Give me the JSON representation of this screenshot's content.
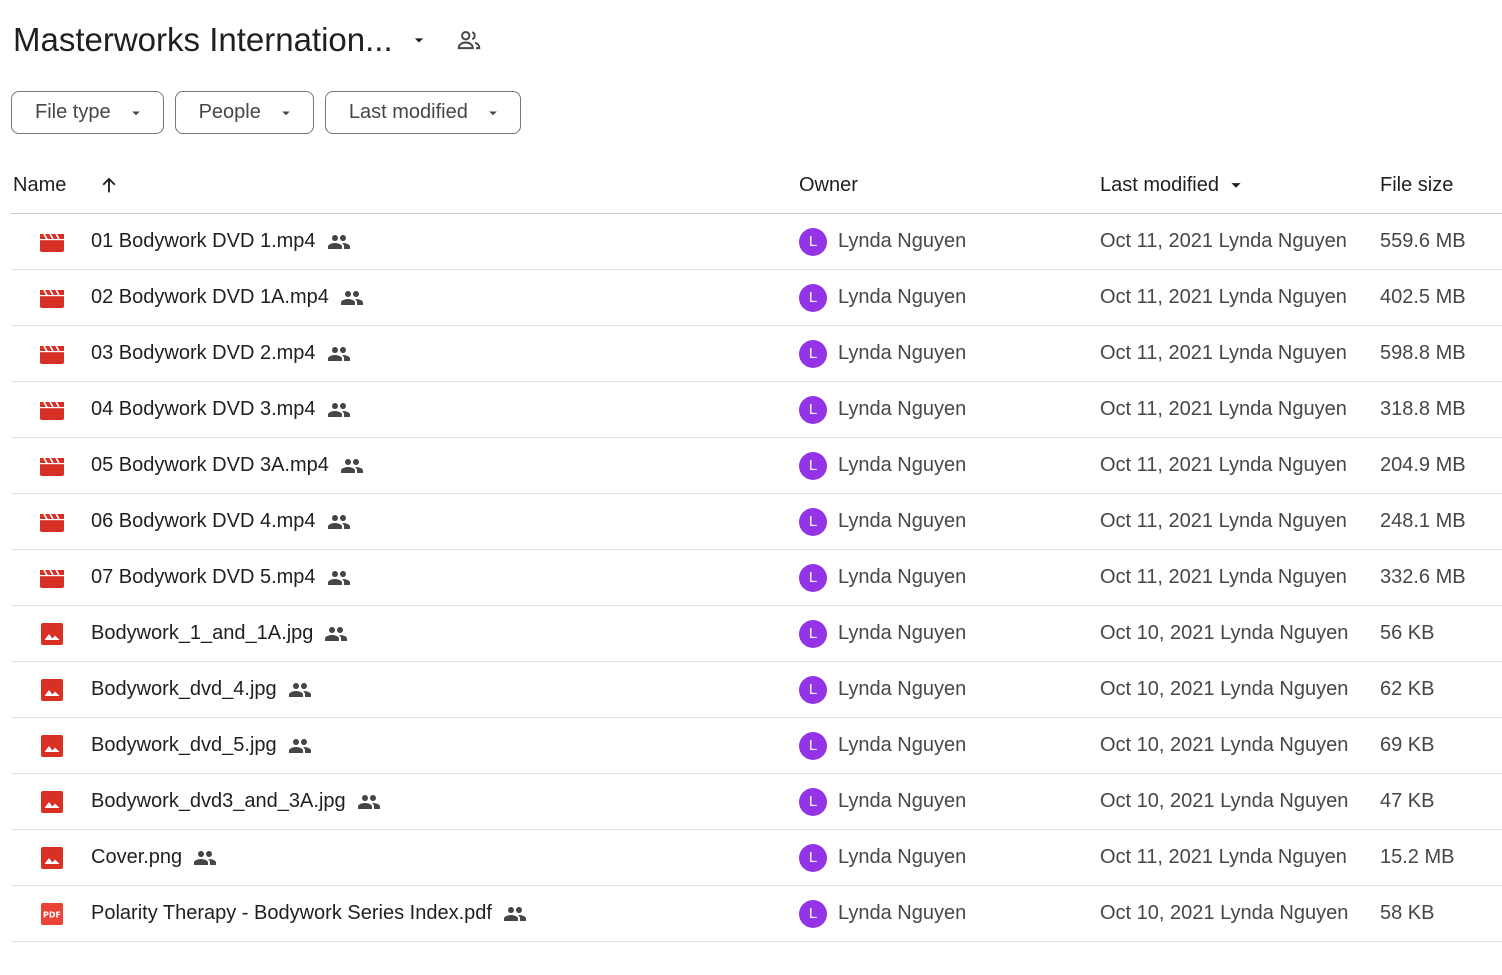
{
  "header": {
    "title": "Masterworks Internation...",
    "title_caret_icon": "arrow-drop-down-icon",
    "shared_icon": "people-outline-icon"
  },
  "filters": [
    {
      "label": "File type"
    },
    {
      "label": "People"
    },
    {
      "label": "Last modified"
    }
  ],
  "columns": {
    "name": "Name",
    "owner": "Owner",
    "last_modified": "Last modified",
    "file_size": "File size"
  },
  "colors": {
    "video_icon": "#d93025",
    "image_icon": "#d93025",
    "pdf_icon": "#ea4335",
    "avatar": "#9334e6",
    "divider": "#e1e3e1"
  },
  "files": [
    {
      "type": "video",
      "name": "01 Bodywork DVD 1.mp4",
      "owner_initial": "L",
      "owner": "Lynda Nguyen",
      "modified": "Oct 11, 2021 Lynda Nguyen",
      "size": "559.6 MB"
    },
    {
      "type": "video",
      "name": "02 Bodywork DVD 1A.mp4",
      "owner_initial": "L",
      "owner": "Lynda Nguyen",
      "modified": "Oct 11, 2021 Lynda Nguyen",
      "size": "402.5 MB"
    },
    {
      "type": "video",
      "name": "03 Bodywork DVD 2.mp4",
      "owner_initial": "L",
      "owner": "Lynda Nguyen",
      "modified": "Oct 11, 2021 Lynda Nguyen",
      "size": "598.8 MB"
    },
    {
      "type": "video",
      "name": "04 Bodywork DVD 3.mp4",
      "owner_initial": "L",
      "owner": "Lynda Nguyen",
      "modified": "Oct 11, 2021 Lynda Nguyen",
      "size": "318.8 MB"
    },
    {
      "type": "video",
      "name": "05 Bodywork DVD 3A.mp4",
      "owner_initial": "L",
      "owner": "Lynda Nguyen",
      "modified": "Oct 11, 2021 Lynda Nguyen",
      "size": "204.9 MB"
    },
    {
      "type": "video",
      "name": "06 Bodywork DVD 4.mp4",
      "owner_initial": "L",
      "owner": "Lynda Nguyen",
      "modified": "Oct 11, 2021 Lynda Nguyen",
      "size": "248.1 MB"
    },
    {
      "type": "video",
      "name": "07 Bodywork DVD 5.mp4",
      "owner_initial": "L",
      "owner": "Lynda Nguyen",
      "modified": "Oct 11, 2021 Lynda Nguyen",
      "size": "332.6 MB"
    },
    {
      "type": "image",
      "name": "Bodywork_1_and_1A.jpg",
      "owner_initial": "L",
      "owner": "Lynda Nguyen",
      "modified": "Oct 10, 2021 Lynda Nguyen",
      "size": "56 KB"
    },
    {
      "type": "image",
      "name": "Bodywork_dvd_4.jpg",
      "owner_initial": "L",
      "owner": "Lynda Nguyen",
      "modified": "Oct 10, 2021 Lynda Nguyen",
      "size": "62 KB"
    },
    {
      "type": "image",
      "name": "Bodywork_dvd_5.jpg",
      "owner_initial": "L",
      "owner": "Lynda Nguyen",
      "modified": "Oct 10, 2021 Lynda Nguyen",
      "size": "69 KB"
    },
    {
      "type": "image",
      "name": "Bodywork_dvd3_and_3A.jpg",
      "owner_initial": "L",
      "owner": "Lynda Nguyen",
      "modified": "Oct 10, 2021 Lynda Nguyen",
      "size": "47 KB"
    },
    {
      "type": "image",
      "name": "Cover.png",
      "owner_initial": "L",
      "owner": "Lynda Nguyen",
      "modified": "Oct 11, 2021 Lynda Nguyen",
      "size": "15.2 MB"
    },
    {
      "type": "pdf",
      "name": "Polarity Therapy - Bodywork Series Index.pdf",
      "owner_initial": "L",
      "owner": "Lynda Nguyen",
      "modified": "Oct 10, 2021 Lynda Nguyen",
      "size": "58 KB"
    }
  ]
}
